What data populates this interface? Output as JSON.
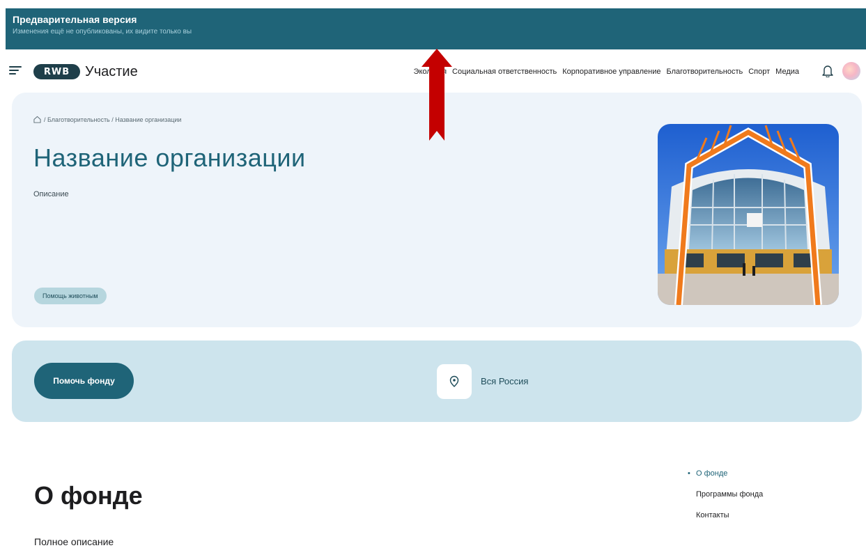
{
  "preview": {
    "title": "Предварительная версия",
    "subtitle": "Изменения ещё не опубликованы, их видите только вы"
  },
  "header": {
    "logo_text": "RWB",
    "brand": "Участие",
    "nav": [
      "Экология",
      "Социальная ответственность",
      "Корпоративное управление",
      "Благотворительность",
      "Спорт",
      "Медиа"
    ]
  },
  "hero": {
    "breadcrumb": "/ Благотворительность / Название организации",
    "title": "Название организации",
    "description": "Описание",
    "tag": "Помощь животным"
  },
  "actions": {
    "help_button": "Помочь фонду",
    "location": "Вся Россия"
  },
  "about": {
    "title": "О фонде",
    "description": "Полное описание",
    "toc": [
      "О фонде",
      "Программы фонда",
      "Контакты"
    ]
  },
  "colors": {
    "brand": "#1f6478",
    "hero_bg": "#eef4fa",
    "action_bg": "#cde4ed",
    "annotation_arrow": "#c40000"
  }
}
